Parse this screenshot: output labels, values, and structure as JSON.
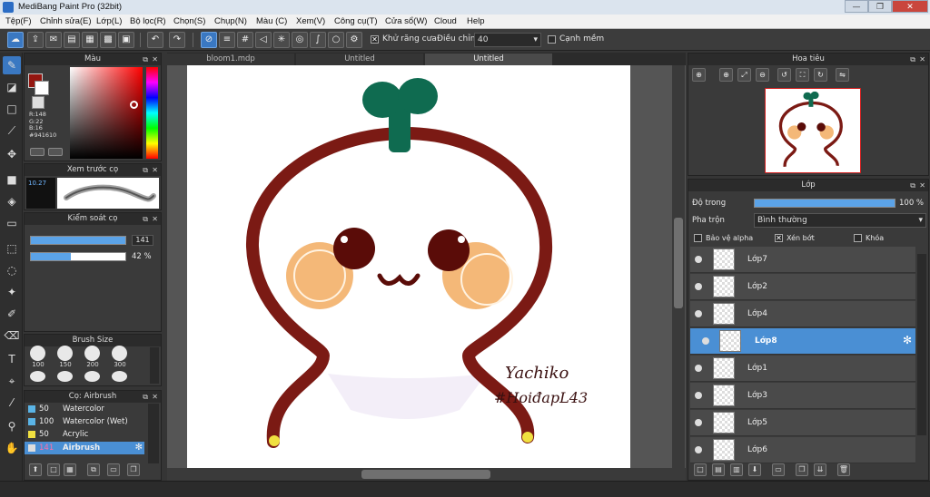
{
  "window": {
    "title": "MediBang Paint Pro (32bit)",
    "minimize": "—",
    "maximize": "❐",
    "close": "✕"
  },
  "menu": [
    "Tệp(F)",
    "Chỉnh sửa(E)",
    "Lớp(L)",
    "Bộ lọc(R)",
    "Chọn(S)",
    "Chụp(N)",
    "Màu (C)",
    "Xem(V)",
    "Công cụ(T)",
    "Cửa sổ(W)",
    "Cloud",
    "Help"
  ],
  "toolbar": {
    "antialias_label": "Khử răng cưa",
    "adjust_label": "Điều chỉnh",
    "adjust_value": "40",
    "edge_label": "Cạnh mềm",
    "antialias_checked": "✕"
  },
  "tabs": [
    "bloom1.mdp",
    "Untitled",
    "Untitled"
  ],
  "color_panel": {
    "title": "Màu",
    "rgb_r": "R:148",
    "rgb_g": "G:22",
    "rgb_b": "B:16",
    "hex": "#941610",
    "current_color": "#941610"
  },
  "brush_preview": {
    "title": "Xem trước cọ",
    "size": "10.27"
  },
  "brush_control": {
    "title": "Kiểm soát cọ",
    "size_value": "141",
    "opacity_value": "42 %",
    "size_fill": 1.0,
    "opacity_fill": 0.42
  },
  "brush_size": {
    "title": "Brush Size",
    "sizes": [
      "100",
      "150",
      "200",
      "300"
    ]
  },
  "brush_list": {
    "title": "Cọ: Airbrush",
    "items": [
      {
        "size": "50",
        "name": "Watercolor",
        "swatch": "#5ab4e6"
      },
      {
        "size": "100",
        "name": "Watercolor (Wet)",
        "swatch": "#5ab4e6"
      },
      {
        "size": "50",
        "name": "Acrylic",
        "swatch": "#f0e040"
      },
      {
        "size": "141",
        "name": "Airbrush",
        "swatch": "#dddddd"
      }
    ]
  },
  "navigator": {
    "title": "Hoa tiêu"
  },
  "layers_panel": {
    "title": "Lớp",
    "opacity_label": "Độ trong",
    "opacity_value": "100 %",
    "opacity_fill": 1.0,
    "blend_label": "Pha trộn",
    "blend_value": "Bình thường",
    "protect_alpha": "Bảo vệ alpha",
    "clipping": "Xén bớt",
    "lock": "Khóa",
    "clipping_checked": "✕",
    "layers": [
      "Lớp7",
      "Lớp2",
      "Lớp4",
      "Lớp8",
      "Lớp1",
      "Lớp3",
      "Lớp5",
      "Lớp6"
    ],
    "selected_layer": "Lớp8"
  },
  "artwork": {
    "signature_line1": "Yachiko",
    "signature_line2": "#HoiđapL43"
  }
}
